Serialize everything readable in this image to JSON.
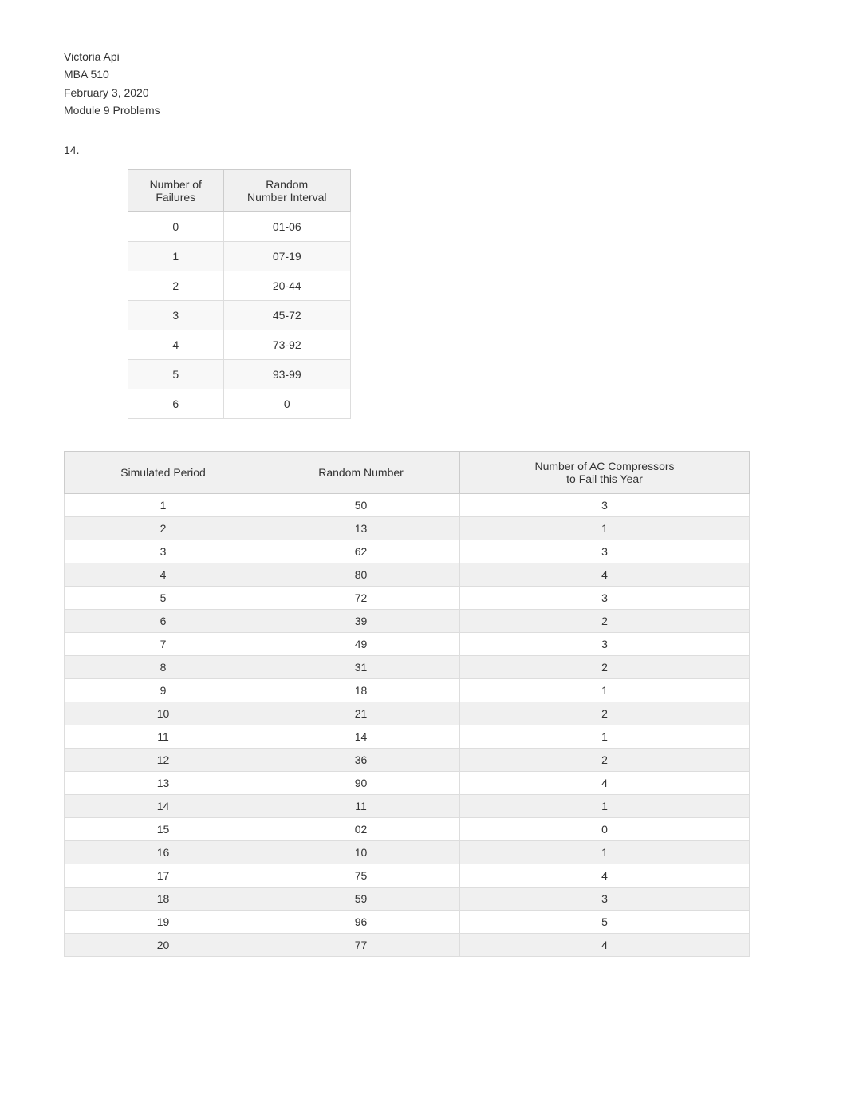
{
  "header": {
    "name": "Victoria Api",
    "course": "MBA 510",
    "date": "February 3, 2020",
    "module": "Module 9 Problems"
  },
  "problem_number": "14.",
  "small_table": {
    "col1_header": "Number of\nFailures",
    "col2_header": "Random\nNumber Interval",
    "rows": [
      {
        "failures": "0",
        "interval": "01-06"
      },
      {
        "failures": "1",
        "interval": "07-19"
      },
      {
        "failures": "2",
        "interval": "20-44"
      },
      {
        "failures": "3",
        "interval": "45-72"
      },
      {
        "failures": "4",
        "interval": "73-92"
      },
      {
        "failures": "5",
        "interval": "93-99"
      },
      {
        "failures": "6",
        "interval": "0"
      }
    ]
  },
  "large_table": {
    "col1_header": "Simulated Period",
    "col2_header": "Random Number",
    "col3_header": "Number of AC Compressors\nto Fail this Year",
    "rows": [
      {
        "period": "1",
        "random": "50",
        "failures": "3"
      },
      {
        "period": "2",
        "random": "13",
        "failures": "1"
      },
      {
        "period": "3",
        "random": "62",
        "failures": "3"
      },
      {
        "period": "4",
        "random": "80",
        "failures": "4"
      },
      {
        "period": "5",
        "random": "72",
        "failures": "3"
      },
      {
        "period": "6",
        "random": "39",
        "failures": "2"
      },
      {
        "period": "7",
        "random": "49",
        "failures": "3"
      },
      {
        "period": "8",
        "random": "31",
        "failures": "2"
      },
      {
        "period": "9",
        "random": "18",
        "failures": "1"
      },
      {
        "period": "10",
        "random": "21",
        "failures": "2"
      },
      {
        "period": "11",
        "random": "14",
        "failures": "1"
      },
      {
        "period": "12",
        "random": "36",
        "failures": "2"
      },
      {
        "period": "13",
        "random": "90",
        "failures": "4"
      },
      {
        "period": "14",
        "random": "11",
        "failures": "1"
      },
      {
        "period": "15",
        "random": "02",
        "failures": "0"
      },
      {
        "period": "16",
        "random": "10",
        "failures": "1"
      },
      {
        "period": "17",
        "random": "75",
        "failures": "4"
      },
      {
        "period": "18",
        "random": "59",
        "failures": "3"
      },
      {
        "period": "19",
        "random": "96",
        "failures": "5"
      },
      {
        "period": "20",
        "random": "77",
        "failures": "4"
      }
    ]
  }
}
